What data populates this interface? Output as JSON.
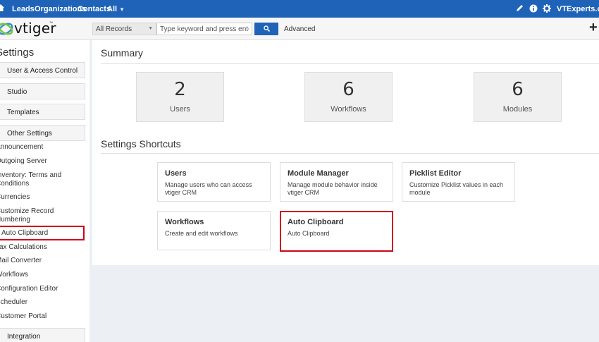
{
  "topnav": {
    "items": [
      {
        "label": "Leads"
      },
      {
        "label": "Organizations"
      },
      {
        "label": "Contacts"
      },
      {
        "label": "All"
      }
    ],
    "user_label": "VTExperts.com"
  },
  "header": {
    "logo_text": "vtiger",
    "logo_tm": "™",
    "records_select": "All Records",
    "search_placeholder": "Type keyword and press enter",
    "advanced_label": "Advanced",
    "add_label": "+"
  },
  "sidebar": {
    "title": "Settings",
    "sections": {
      "user_access": "User & Access Control",
      "studio": "Studio",
      "templates": "Templates",
      "other": "Other Settings",
      "integration": "Integration"
    },
    "links": [
      {
        "label": "Announcement"
      },
      {
        "label": "Outgoing Server"
      },
      {
        "label": "Inventory: Terms and Conditions"
      },
      {
        "label": "Currencies"
      },
      {
        "label": "Customize Record Numbering"
      },
      {
        "label": "Auto Clipboard"
      },
      {
        "label": "Tax Calculations"
      },
      {
        "label": "Mail Converter"
      },
      {
        "label": "Workflows"
      },
      {
        "label": "Configuration Editor"
      },
      {
        "label": "Scheduler"
      },
      {
        "label": "Customer Portal"
      }
    ]
  },
  "summary": {
    "title": "Summary",
    "stats": [
      {
        "value": "2",
        "label": "Users"
      },
      {
        "value": "6",
        "label": "Workflows"
      },
      {
        "value": "6",
        "label": "Modules"
      }
    ]
  },
  "shortcuts": {
    "title": "Settings Shortcuts",
    "cards": [
      {
        "title": "Users",
        "desc": "Manage users who can access vtiger CRM"
      },
      {
        "title": "Module Manager",
        "desc": "Manage module behavior inside vtiger CRM"
      },
      {
        "title": "Picklist Editor",
        "desc": "Customize Picklist values in each module"
      },
      {
        "title": "Workflows",
        "desc": "Create and edit workflows"
      },
      {
        "title": "Auto Clipboard",
        "desc": "Auto Clipboard"
      }
    ]
  },
  "colors": {
    "nav_blue": "#1f63b9",
    "highlight_red": "#d0021b"
  }
}
